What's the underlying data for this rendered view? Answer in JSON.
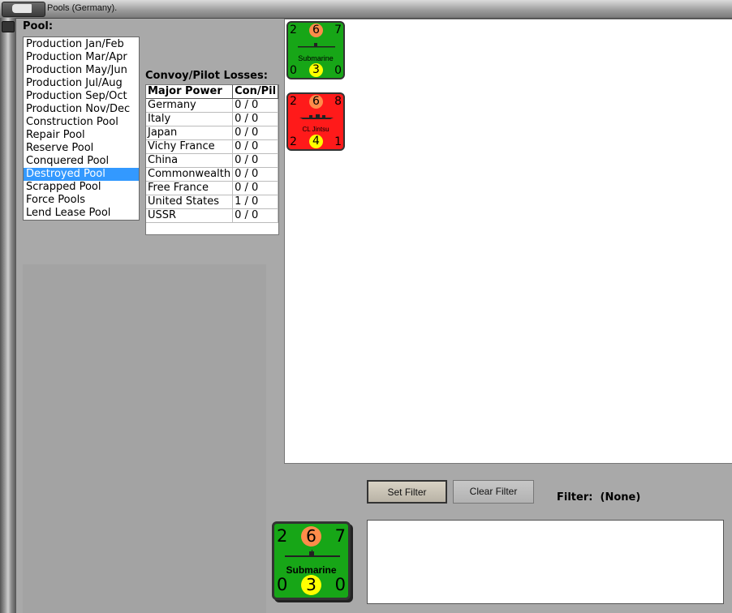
{
  "window": {
    "title": "Pools (Germany)."
  },
  "pool_label": "Pool:",
  "pools": [
    "Production Jan/Feb",
    "Production Mar/Apr",
    "Production May/Jun",
    "Production Jul/Aug",
    "Production Sep/Oct",
    "Production Nov/Dec",
    "Construction Pool",
    "Repair Pool",
    "Reserve Pool",
    "Conquered Pool",
    "Destroyed Pool",
    "Scrapped Pool",
    "Force Pools",
    "Lend Lease Pool"
  ],
  "selected_pool": "Destroyed Pool",
  "convoy": {
    "label": "Convoy/Pilot Losses:",
    "headers": [
      "Major Power",
      "Con/Pil"
    ],
    "rows": [
      [
        "Germany",
        "0 / 0"
      ],
      [
        "Italy",
        "0 / 0"
      ],
      [
        "Japan",
        "0 / 0"
      ],
      [
        "Vichy France",
        "0 / 0"
      ],
      [
        "China",
        "0 / 0"
      ],
      [
        "Commonwealth",
        "0 / 0"
      ],
      [
        "Free France",
        "0 / 0"
      ],
      [
        "United States",
        "1 / 0"
      ],
      [
        "USSR",
        "0 / 0"
      ]
    ]
  },
  "units": [
    {
      "name": "Submarine",
      "color": "#17a617",
      "tl": "2",
      "top": "6",
      "tr": "7",
      "bl": "0",
      "bottom": "3",
      "br": "0"
    },
    {
      "name": "CL Jintsu",
      "color": "#ff1a1a",
      "tl": "2",
      "top": "6",
      "tr": "8",
      "bl": "2",
      "bottom": "4",
      "br": "1"
    }
  ],
  "selected_unit": {
    "name": "Submarine",
    "tl": "2",
    "top": "6",
    "tr": "7",
    "bl": "0",
    "bottom": "3",
    "br": "0"
  },
  "buttons": {
    "set_filter": "Set Filter",
    "clear_filter": "Clear Filter"
  },
  "filter": {
    "label": "Filter:",
    "value": "(None)"
  },
  "colors": {
    "selection": "#3399ff",
    "submarine_counter": "#17a617",
    "cruiser_counter": "#ff1a1a"
  }
}
